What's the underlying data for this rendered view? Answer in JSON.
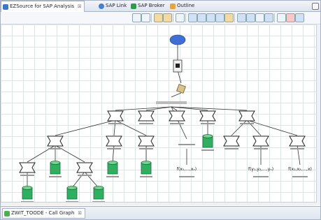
{
  "tabs": [
    {
      "label": "EZSource for SAP Analysis",
      "active": true,
      "close": "☒"
    },
    {
      "label": "SAP Link"
    },
    {
      "label": "SAP Broker"
    },
    {
      "label": "Outline"
    }
  ],
  "bottom_tab": {
    "label": "ZWIT_TOODE - Call Graph",
    "close": "☒"
  },
  "graph": {
    "formulas": [
      {
        "id": "f1",
        "text": "f(x₁,...,xₙ)"
      },
      {
        "id": "f2",
        "text": "f(y₁,y₂,...,yₙ)"
      },
      {
        "id": "f3",
        "text": "f(x₁,x₂,...,x)"
      }
    ]
  },
  "colors": {
    "db": "#2fb060",
    "dbTop": "#6fd58f",
    "cloud": "#3d6fd6"
  }
}
